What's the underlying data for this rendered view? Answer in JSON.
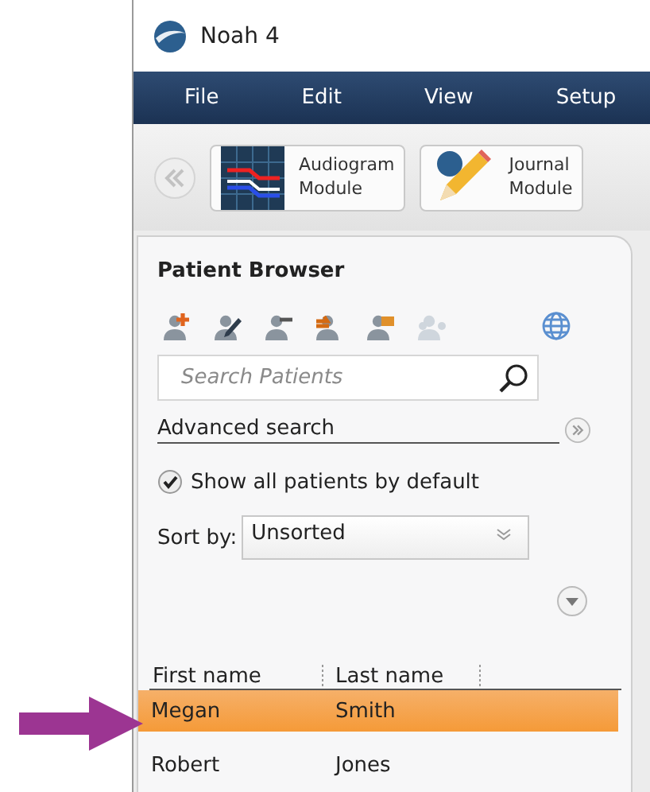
{
  "window": {
    "title": "Noah 4"
  },
  "menu": [
    {
      "label": "File"
    },
    {
      "label": "Edit"
    },
    {
      "label": "View"
    },
    {
      "label": "Setup"
    }
  ],
  "modules": [
    {
      "kind": "audiogram",
      "lines": [
        "Audiogram",
        "Module"
      ]
    },
    {
      "kind": "journal",
      "lines": [
        "Journal",
        "Module"
      ]
    }
  ],
  "patient_browser": {
    "title": "Patient Browser",
    "toolbar": [
      {
        "kind": "add",
        "disabled": false
      },
      {
        "kind": "edit",
        "disabled": false
      },
      {
        "kind": "remove",
        "disabled": false
      },
      {
        "kind": "transfer",
        "disabled": false
      },
      {
        "kind": "open",
        "disabled": false
      },
      {
        "kind": "group",
        "disabled": true
      },
      {
        "kind": "globe",
        "disabled": false
      }
    ],
    "search": {
      "placeholder": "Search Patients"
    },
    "advanced_search": "Advanced search",
    "show_all": {
      "label": "Show all patients by default",
      "checked": true
    },
    "sort": {
      "label": "Sort by:",
      "value": "Unsorted"
    },
    "table": {
      "columns": [
        "First name",
        "Last name"
      ],
      "rows": [
        {
          "cells": [
            "Megan",
            "Smith"
          ],
          "selected": true
        },
        {
          "cells": [
            "Robert",
            "Jones"
          ],
          "selected": false
        }
      ]
    }
  }
}
